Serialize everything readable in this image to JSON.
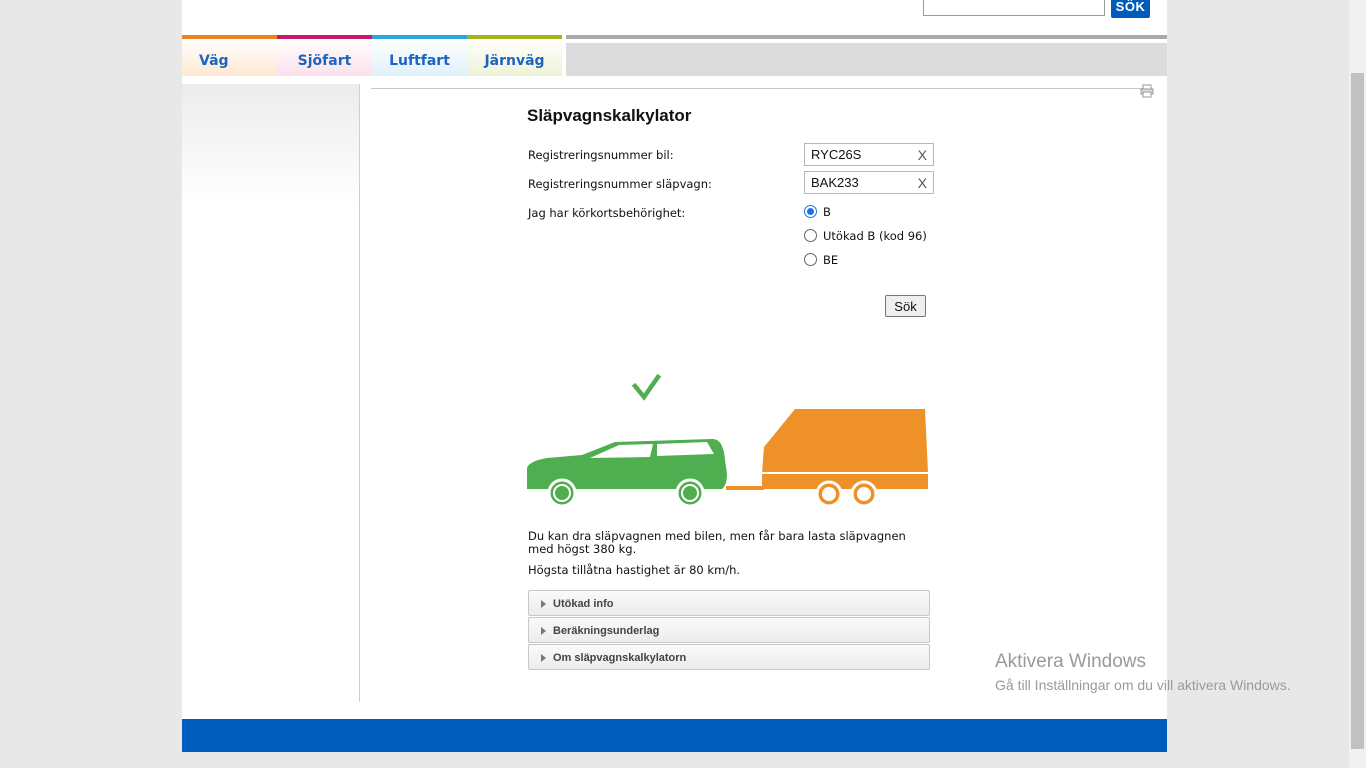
{
  "header": {
    "search_placeholder": "",
    "search_button": "SÖK"
  },
  "nav": {
    "tabs": [
      {
        "label": "Väg",
        "color": "#e8841d"
      },
      {
        "label": "Sjöfart",
        "color": "#c8186a"
      },
      {
        "label": "Luftfart",
        "color": "#2aa6dc"
      },
      {
        "label": "Järnväg",
        "color": "#a5b31a"
      }
    ]
  },
  "form": {
    "title": "Släpvagnskalkylator",
    "car_reg_label": "Registreringsnummer bil:",
    "car_reg_value": "RYC26S",
    "trailer_reg_label": "Registreringsnummer släpvagn:",
    "trailer_reg_value": "BAK233",
    "clear_label": "X",
    "license_label": "Jag har körkortsbehörighet:",
    "license_options": [
      {
        "label": "B",
        "checked": true
      },
      {
        "label": "Utökad B (kod 96)",
        "checked": false
      },
      {
        "label": "BE",
        "checked": false
      }
    ],
    "submit_label": "Sök"
  },
  "result": {
    "car_status_icon": "check-icon",
    "trailer_status_icon": "exclamation-icon",
    "car_color": "#4fae4f",
    "trailer_color": "#ee9128",
    "message": "Du kan dra släpvagnen med bilen, men får bara lasta släpvagnen med högst 380 kg.",
    "speed": "Högsta tillåtna hastighet är 80 km/h."
  },
  "accordions": [
    {
      "label": "Utökad info"
    },
    {
      "label": "Beräkningsunderlag"
    },
    {
      "label": "Om släpvagnskalkylatorn"
    }
  ],
  "watermark": {
    "title": "Aktivera Windows",
    "subtitle": "Gå till Inställningar om du vill aktivera Windows."
  },
  "colors": {
    "brand_blue": "#005cbc"
  }
}
